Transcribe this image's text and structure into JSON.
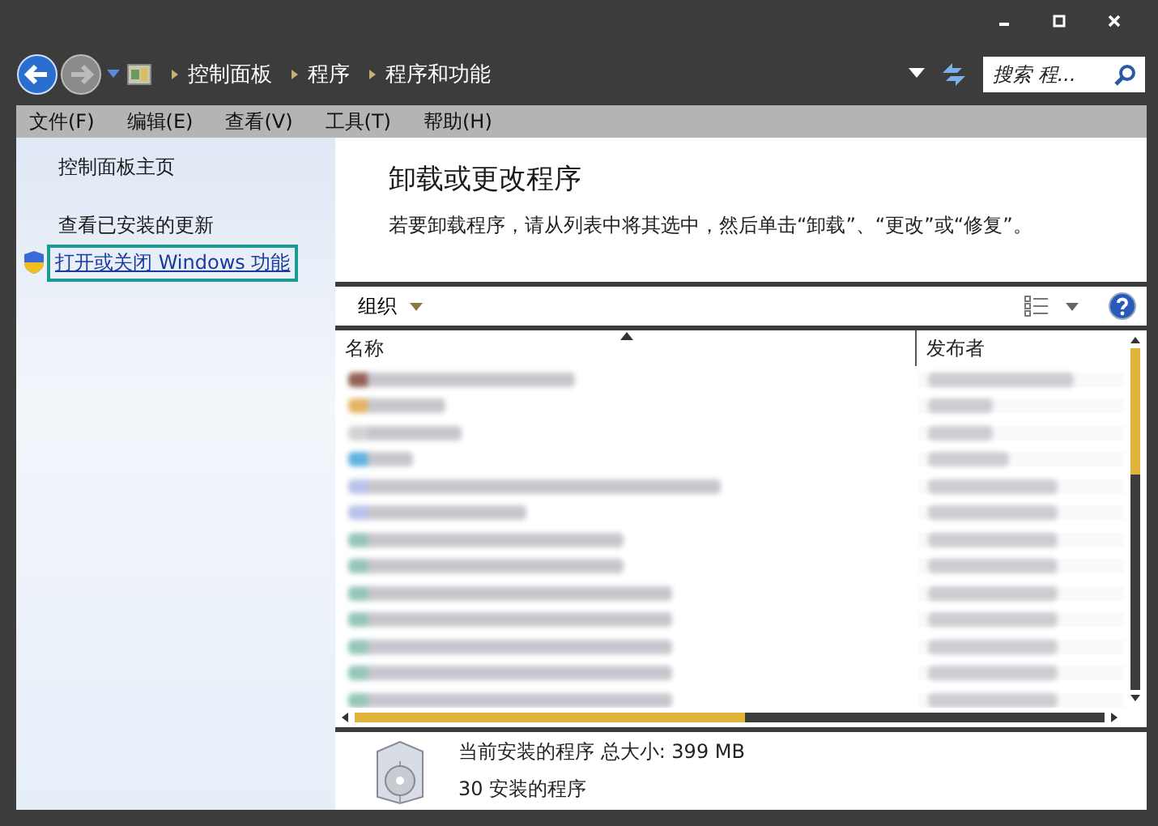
{
  "breadcrumb": [
    "控制面板",
    "程序",
    "程序和功能"
  ],
  "search": {
    "placeholder": "搜索 程..."
  },
  "menu": [
    "文件(F)",
    "编辑(E)",
    "查看(V)",
    "工具(T)",
    "帮助(H)"
  ],
  "sidebar": {
    "items": [
      {
        "label": "控制面板主页",
        "kind": "link",
        "highlighted": false
      },
      {
        "label": "查看已安装的更新",
        "kind": "link",
        "highlighted": false
      },
      {
        "label": "打开或关闭 Windows 功能",
        "kind": "shield-link",
        "highlighted": true
      }
    ]
  },
  "main": {
    "title": "卸载或更改程序",
    "description": "若要卸载程序，请从列表中将其选中，然后单击“卸载”、“更改”或“修复”。"
  },
  "toolbar": {
    "organize": "组织"
  },
  "table": {
    "columns": [
      "名称",
      "发布者"
    ]
  },
  "footer": {
    "summary": "当前安装的程序 总大小: 399 MB",
    "count": "30 安装的程序"
  }
}
